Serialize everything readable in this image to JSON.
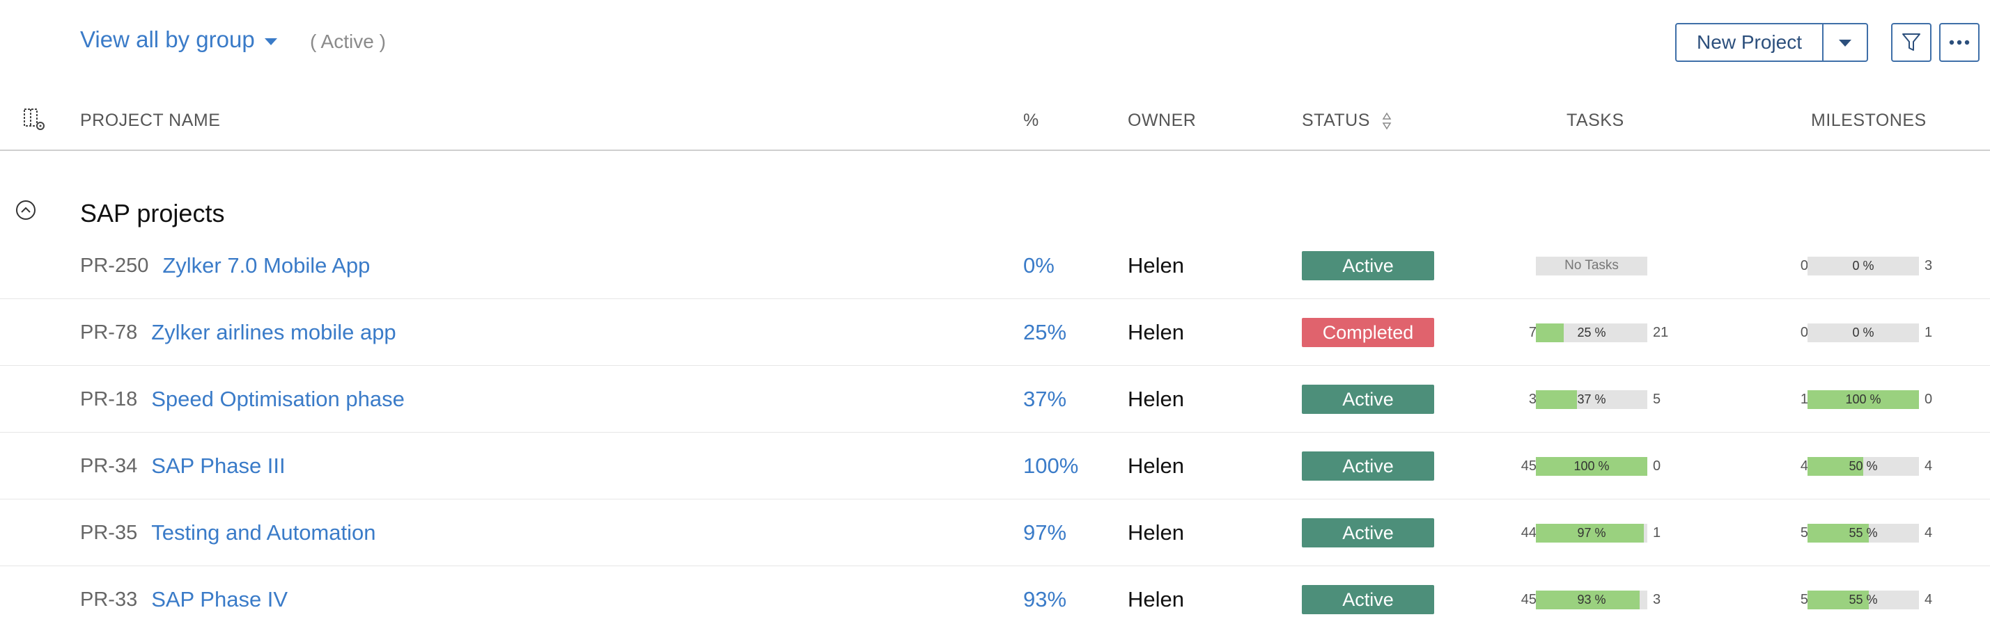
{
  "toolbar": {
    "view_label": "View all by group",
    "filter_text": "( Active )",
    "new_project_label": "New Project",
    "icons": {
      "dropdown": "chevron-down-icon",
      "filter": "filter-icon",
      "more": "more-icon"
    }
  },
  "header": {
    "columns": {
      "name": "PROJECT NAME",
      "percent": "%",
      "owner": "OWNER",
      "status": "STATUS",
      "tasks": "TASKS",
      "milestones": "MILESTONES"
    },
    "icons": {
      "column_config": "column-settings-icon",
      "sort": "sort-icon"
    }
  },
  "group": {
    "title": "SAP projects",
    "icon": "collapse-icon"
  },
  "colors": {
    "link": "#3a7bc8",
    "active": "#4d8f7a",
    "completed": "#e0636d",
    "bar_fill": "#9ad17f",
    "bar_bg": "#e3e3e3"
  },
  "rows": [
    {
      "id": "PR-250",
      "name": "Zylker 7.0 Mobile App",
      "percent": "0%",
      "owner": "Helen",
      "status": "Active",
      "status_color": "#4d8f7a",
      "tasks": {
        "left": "",
        "right": "",
        "label": "No Tasks",
        "fill": 0
      },
      "milestones": {
        "left": "0",
        "right": "3",
        "label": "0 %",
        "fill": 0
      }
    },
    {
      "id": "PR-78",
      "name": "Zylker airlines mobile app",
      "percent": "25%",
      "owner": "Helen",
      "status": "Completed",
      "status_color": "#e0636d",
      "tasks": {
        "left": "7",
        "right": "21",
        "label": "25 %",
        "fill": 0.25
      },
      "milestones": {
        "left": "0",
        "right": "1",
        "label": "0 %",
        "fill": 0
      }
    },
    {
      "id": "PR-18",
      "name": "Speed Optimisation phase",
      "percent": "37%",
      "owner": "Helen",
      "status": "Active",
      "status_color": "#4d8f7a",
      "tasks": {
        "left": "3",
        "right": "5",
        "label": "37 %",
        "fill": 0.37
      },
      "milestones": {
        "left": "1",
        "right": "0",
        "label": "100 %",
        "fill": 1.0
      }
    },
    {
      "id": "PR-34",
      "name": "SAP Phase III",
      "percent": "100%",
      "owner": "Helen",
      "status": "Active",
      "status_color": "#4d8f7a",
      "tasks": {
        "left": "45",
        "right": "0",
        "label": "100 %",
        "fill": 1.0
      },
      "milestones": {
        "left": "4",
        "right": "4",
        "label": "50 %",
        "fill": 0.5
      }
    },
    {
      "id": "PR-35",
      "name": "Testing and Automation",
      "percent": "97%",
      "owner": "Helen",
      "status": "Active",
      "status_color": "#4d8f7a",
      "tasks": {
        "left": "44",
        "right": "1",
        "label": "97 %",
        "fill": 0.97
      },
      "milestones": {
        "left": "5",
        "right": "4",
        "label": "55 %",
        "fill": 0.55
      }
    },
    {
      "id": "PR-33",
      "name": "SAP Phase IV",
      "percent": "93%",
      "owner": "Helen",
      "status": "Active",
      "status_color": "#4d8f7a",
      "tasks": {
        "left": "45",
        "right": "3",
        "label": "93 %",
        "fill": 0.93
      },
      "milestones": {
        "left": "5",
        "right": "4",
        "label": "55 %",
        "fill": 0.55
      }
    }
  ]
}
